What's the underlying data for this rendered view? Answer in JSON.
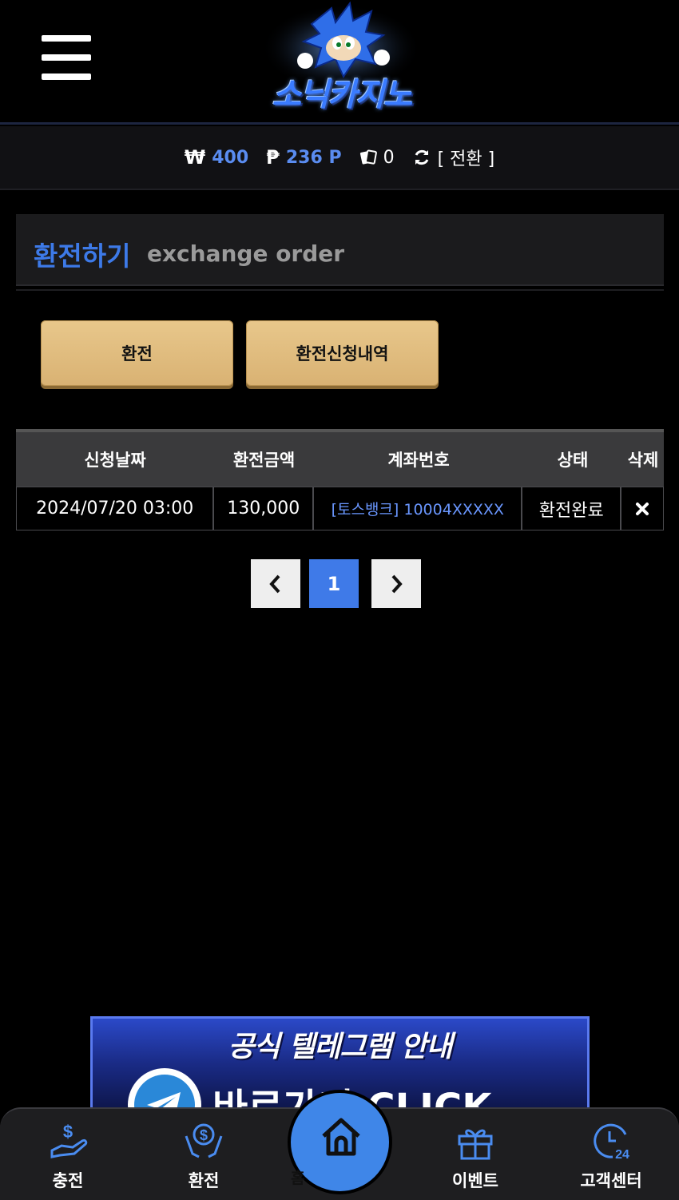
{
  "header": {
    "logo_text": "소닉카지노",
    "menu_icon": "hamburger-menu-icon"
  },
  "balance": {
    "won_symbol": "₩",
    "won_value": "400",
    "point_symbol": "₱",
    "point_value": "236 P",
    "chip_value": "0",
    "convert_label": "[ 전환 ]"
  },
  "page": {
    "title_ko": "환전하기",
    "title_en": "exchange order"
  },
  "buttons": {
    "exchange": "환전",
    "history": "환전신청내역"
  },
  "table": {
    "headers": [
      "신청날짜",
      "환전금액",
      "계좌번호",
      "상태",
      "삭제"
    ],
    "rows": [
      {
        "date": "2024/07/20 03:00",
        "amount": "130,000",
        "account": "[토스뱅크] 10004XXXXX",
        "status": "환전완료"
      }
    ]
  },
  "pagination": {
    "current": "1"
  },
  "banner": {
    "title": "공식 텔레그램 안내",
    "subtitle": "바로가기 CLICK"
  },
  "bottom_nav": {
    "charge": "충전",
    "exchange": "환전",
    "home": "홈",
    "event": "이벤트",
    "support": "고객센터"
  },
  "colors": {
    "accent_blue": "#3f7ae8",
    "gold_button": "#e3bf80",
    "background": "#000000"
  }
}
